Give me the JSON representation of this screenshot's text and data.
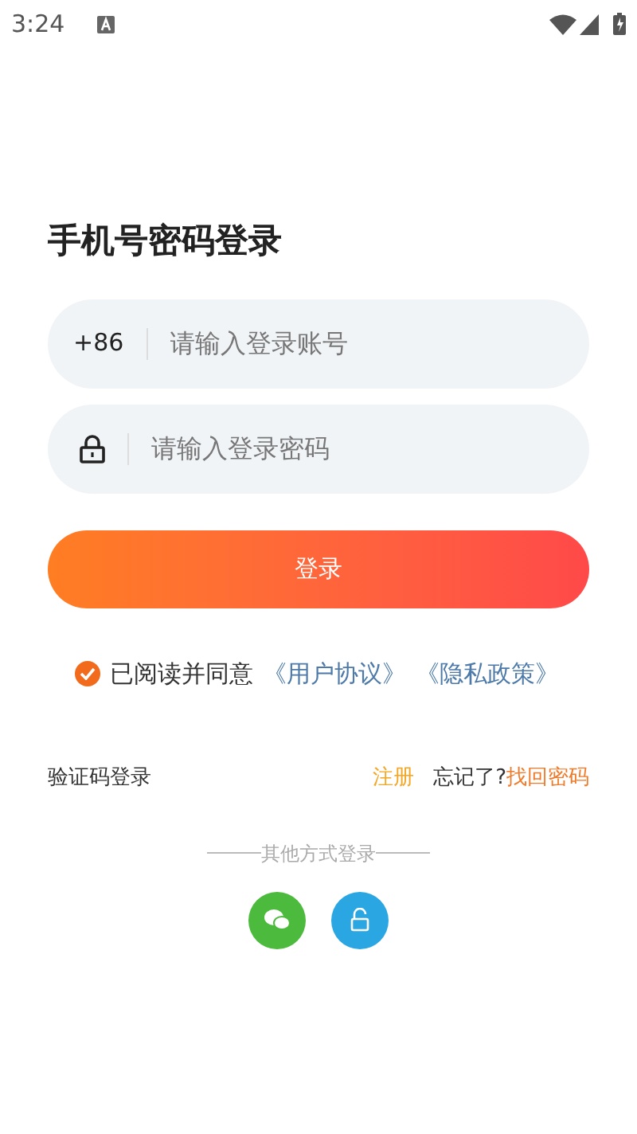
{
  "status_bar": {
    "time": "3:24"
  },
  "title": "手机号密码登录",
  "account_field": {
    "prefix": "+86",
    "placeholder": "请输入登录账号"
  },
  "password_field": {
    "placeholder": "请输入登录密码"
  },
  "login_button": "登录",
  "agreement": {
    "checked": true,
    "text": "已阅读并同意",
    "links": [
      "《用户协议》",
      "《隐私政策》"
    ]
  },
  "links": {
    "sms_login": "验证码登录",
    "register": "注册",
    "forgot": "忘记了?",
    "recover": "找回密码"
  },
  "other_login": {
    "label": "其他方式登录"
  }
}
